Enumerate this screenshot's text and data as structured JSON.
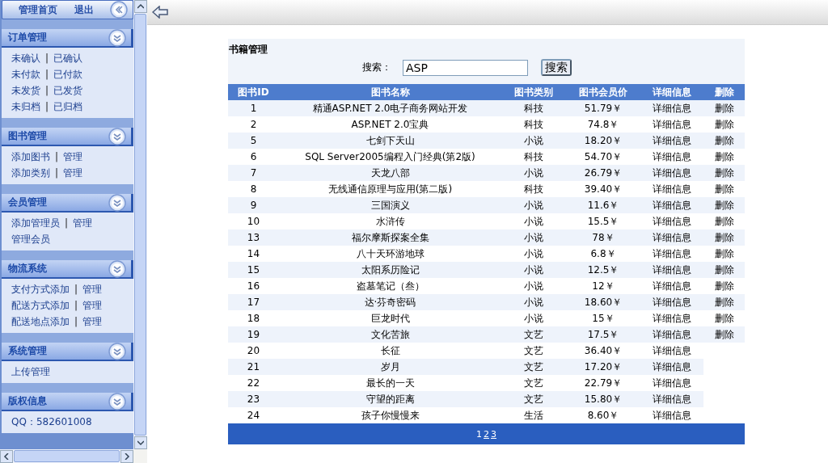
{
  "sidebar": {
    "top": {
      "links": [
        "管理首页",
        "退出"
      ]
    },
    "sections": [
      {
        "title": "订单管理",
        "rows": [
          [
            {
              "kind": "link",
              "text": "未确认"
            },
            {
              "kind": "sep",
              "text": "|"
            },
            {
              "kind": "link",
              "text": "已确认"
            }
          ],
          [
            {
              "kind": "link",
              "text": "未付款"
            },
            {
              "kind": "sep",
              "text": "|"
            },
            {
              "kind": "link",
              "text": "已付款"
            }
          ],
          [
            {
              "kind": "link",
              "text": "未发货"
            },
            {
              "kind": "sep",
              "text": "|"
            },
            {
              "kind": "link",
              "text": "已发货"
            }
          ],
          [
            {
              "kind": "link",
              "text": "未归档"
            },
            {
              "kind": "sep",
              "text": "|"
            },
            {
              "kind": "link",
              "text": "已归档"
            }
          ]
        ]
      },
      {
        "title": "图书管理",
        "rows": [
          [
            {
              "kind": "link",
              "text": "添加图书"
            },
            {
              "kind": "sep",
              "text": "|"
            },
            {
              "kind": "link",
              "text": "管理"
            }
          ],
          [
            {
              "kind": "link",
              "text": "添加类别"
            },
            {
              "kind": "sep",
              "text": "|"
            },
            {
              "kind": "link",
              "text": "管理"
            }
          ]
        ]
      },
      {
        "title": "会员管理",
        "rows": [
          [
            {
              "kind": "link",
              "text": "添加管理员"
            },
            {
              "kind": "sep",
              "text": "|"
            },
            {
              "kind": "link",
              "text": "管理"
            }
          ],
          [
            {
              "kind": "link",
              "text": "管理会员"
            }
          ]
        ]
      },
      {
        "title": "物流系统",
        "rows": [
          [
            {
              "kind": "link",
              "text": "支付方式添加"
            },
            {
              "kind": "sep",
              "text": "|"
            },
            {
              "kind": "link",
              "text": "管理"
            }
          ],
          [
            {
              "kind": "link",
              "text": "配送方式添加"
            },
            {
              "kind": "sep",
              "text": "|"
            },
            {
              "kind": "link",
              "text": "管理"
            }
          ],
          [
            {
              "kind": "link",
              "text": "配送地点添加"
            },
            {
              "kind": "sep",
              "text": "|"
            },
            {
              "kind": "link",
              "text": "管理"
            }
          ]
        ]
      },
      {
        "title": "系统管理",
        "rows": [
          [
            {
              "kind": "link",
              "text": "上传管理"
            }
          ]
        ]
      },
      {
        "title": "版权信息",
        "rows": [
          [
            {
              "kind": "text",
              "text": "QQ：582601008"
            }
          ]
        ]
      }
    ]
  },
  "panel": {
    "title": "书籍管理",
    "search": {
      "label": "搜索：",
      "value": "ASP",
      "button": "搜索"
    },
    "table": {
      "columns": [
        "图书ID",
        "图书名称",
        "图书类别",
        "图书会员价",
        "详细信息",
        "删除"
      ],
      "rows": [
        {
          "id": "1",
          "name": "精通ASP.NET 2.0电子商务网站开发",
          "category": "科技",
          "price": "51.79￥",
          "detail": "详细信息",
          "delete": "删除"
        },
        {
          "id": "2",
          "name": "ASP.NET 2.0宝典",
          "category": "科技",
          "price": "74.8￥",
          "detail": "详细信息",
          "delete": "删除"
        },
        {
          "id": "5",
          "name": "七剑下天山",
          "category": "小说",
          "price": "18.20￥",
          "detail": "详细信息",
          "delete": "删除"
        },
        {
          "id": "6",
          "name": "SQL Server2005编程入门经典(第2版)",
          "category": "科技",
          "price": "54.70￥",
          "detail": "详细信息",
          "delete": "删除"
        },
        {
          "id": "7",
          "name": "天龙八部",
          "category": "小说",
          "price": "26.79￥",
          "detail": "详细信息",
          "delete": "删除"
        },
        {
          "id": "8",
          "name": "无线通信原理与应用(第二版)",
          "category": "科技",
          "price": "39.40￥",
          "detail": "详细信息",
          "delete": "删除"
        },
        {
          "id": "9",
          "name": "三国演义",
          "category": "小说",
          "price": "11.6￥",
          "detail": "详细信息",
          "delete": "删除"
        },
        {
          "id": "10",
          "name": "水浒传",
          "category": "小说",
          "price": "15.5￥",
          "detail": "详细信息",
          "delete": "删除"
        },
        {
          "id": "13",
          "name": "福尔摩斯探案全集",
          "category": "小说",
          "price": "78￥",
          "detail": "详细信息",
          "delete": "删除"
        },
        {
          "id": "14",
          "name": "八十天环游地球",
          "category": "小说",
          "price": "6.8￥",
          "detail": "详细信息",
          "delete": "删除"
        },
        {
          "id": "15",
          "name": "太阳系历险记",
          "category": "小说",
          "price": "12.5￥",
          "detail": "详细信息",
          "delete": "删除"
        },
        {
          "id": "16",
          "name": "盗墓笔记（叁）",
          "category": "小说",
          "price": "12￥",
          "detail": "详细信息",
          "delete": "删除"
        },
        {
          "id": "17",
          "name": "达·芬奇密码",
          "category": "小说",
          "price": "18.60￥",
          "detail": "详细信息",
          "delete": "删除"
        },
        {
          "id": "18",
          "name": "巨龙时代",
          "category": "小说",
          "price": "15￥",
          "detail": "详细信息",
          "delete": "删除"
        },
        {
          "id": "19",
          "name": "文化苦旅",
          "category": "文艺",
          "price": "17.5￥",
          "detail": "详细信息",
          "delete": "删除"
        },
        {
          "id": "20",
          "name": "长征",
          "category": "文艺",
          "price": "36.40￥",
          "detail": "详细信息"
        },
        {
          "id": "21",
          "name": "岁月",
          "category": "文艺",
          "price": "17.20￥",
          "detail": "详细信息"
        },
        {
          "id": "22",
          "name": "最长的一天",
          "category": "文艺",
          "price": "22.79￥",
          "detail": "详细信息"
        },
        {
          "id": "23",
          "name": "守望的距离",
          "category": "文艺",
          "price": "15.80￥",
          "detail": "详细信息"
        },
        {
          "id": "24",
          "name": "孩子你慢慢来",
          "category": "生活",
          "price": "8.60￥",
          "detail": "详细信息"
        }
      ]
    },
    "pages": [
      {
        "label": "1",
        "selected": true
      },
      {
        "label": "2",
        "selected": false
      },
      {
        "label": "3",
        "selected": false
      }
    ]
  }
}
